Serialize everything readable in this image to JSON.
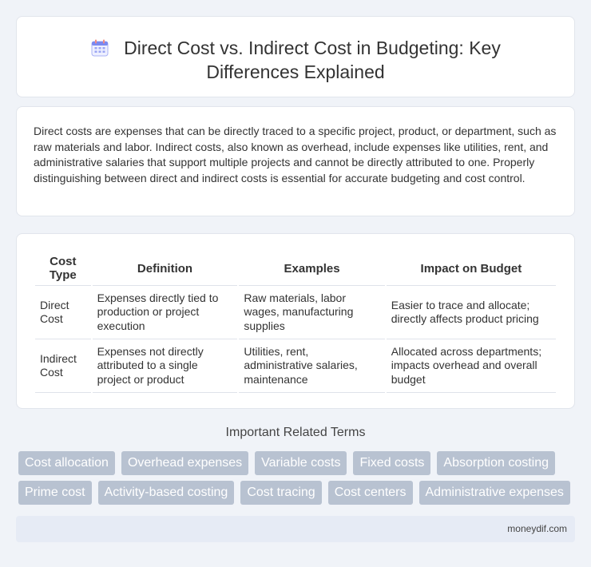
{
  "header": {
    "icon": "calendar-icon",
    "title_line1": "Direct Cost vs. Indirect Cost in Budgeting: Key",
    "title_line2": "Differences Explained"
  },
  "intro": {
    "text": "Direct costs are expenses that can be directly traced to a specific project, product, or department, such as raw materials and labor. Indirect costs, also known as overhead, include expenses like utilities, rent, and administrative salaries that support multiple projects and cannot be directly attributed to one. Properly distinguishing between direct and indirect costs is essential for accurate budgeting and cost control."
  },
  "table": {
    "headers": [
      "Cost Type",
      "Definition",
      "Examples",
      "Impact on Budget"
    ],
    "rows": [
      [
        "Direct Cost",
        "Expenses directly tied to production or project execution",
        "Raw materials, labor wages, manufacturing supplies",
        "Easier to trace and allocate; directly affects product pricing"
      ],
      [
        "Indirect Cost",
        "Expenses not directly attributed to a single project or product",
        "Utilities, rent, administrative salaries, maintenance",
        "Allocated across departments; impacts overhead and overall budget"
      ]
    ]
  },
  "related": {
    "title": "Important Related Terms",
    "row1": [
      "Cost allocation",
      "Overhead expenses",
      "Variable costs",
      "Fixed costs",
      "Absorption costing"
    ],
    "row2": [
      "Prime cost",
      "Activity-based costing",
      "Cost tracing",
      "Cost centers",
      "Administrative expenses"
    ]
  },
  "footer": {
    "site": "moneydif.com"
  }
}
